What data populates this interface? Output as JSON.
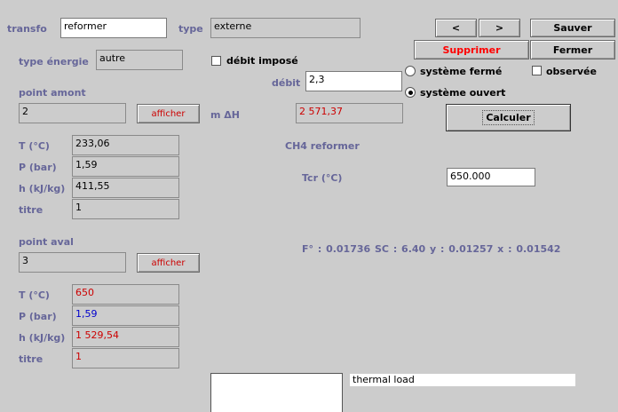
{
  "transfo": {
    "label": "transfo",
    "value": "reformer"
  },
  "type": {
    "label": "type",
    "value": "externe"
  },
  "type_energie": {
    "label": "type énergie",
    "value": "autre"
  },
  "debit_impose": {
    "label": "débit imposé",
    "checked": false
  },
  "debit": {
    "label": "débit",
    "value": "2,3"
  },
  "nav": {
    "prev": "<",
    "next": ">"
  },
  "actions": {
    "save": "Sauver",
    "delete": "Supprimer",
    "close": "Fermer",
    "calculate": "Calculer"
  },
  "systeme": {
    "ferme": "système fermé",
    "ouvert": "système ouvert",
    "selected": "ouvert"
  },
  "observee": {
    "label": "observée",
    "checked": false
  },
  "point_amont": {
    "title": "point amont",
    "value": "2",
    "button": "afficher",
    "rows": [
      {
        "label": "T (°C)",
        "value": "233,06"
      },
      {
        "label": "P (bar)",
        "value": "1,59"
      },
      {
        "label": "h (kJ/kg)",
        "value": "411,55"
      },
      {
        "label": "titre",
        "value": "1"
      }
    ]
  },
  "m_dh": {
    "label": "m ΔH",
    "value": "2 571,37"
  },
  "ch4": {
    "title": "CH4 reformer",
    "tcr_label": "Tcr (°C)",
    "tcr_value": "650.000",
    "summary": "F° : 0.01736  SC : 6.40  y : 0.01257  x : 0.01542"
  },
  "point_aval": {
    "title": "point aval",
    "value": "3",
    "button": "afficher",
    "rows": [
      {
        "label": "T (°C)",
        "value": "650"
      },
      {
        "label": "P (bar)",
        "value": "1,59"
      },
      {
        "label": "h (kJ/kg)",
        "value": "1 529,54"
      },
      {
        "label": "titre",
        "value": "1"
      }
    ]
  },
  "thermal": {
    "value": "thermal load"
  }
}
